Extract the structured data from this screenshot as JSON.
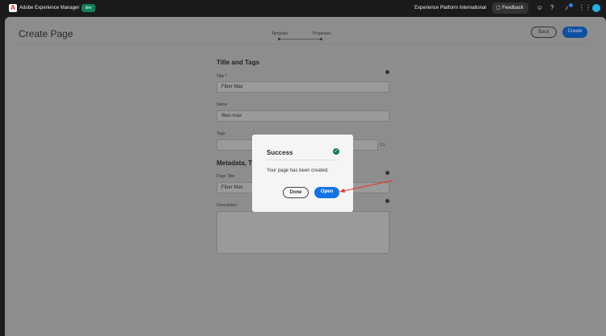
{
  "topbar": {
    "app": "Adobe Experience Manager",
    "env": "dev",
    "org": "Experience Platform International",
    "feedback": "Feedback"
  },
  "header": {
    "title": "Create Page",
    "steps": [
      "Template",
      "Properties"
    ],
    "back": "Back",
    "create": "Create"
  },
  "form": {
    "section1": "Title and Tags",
    "title_label": "Title *",
    "title_value": "Fiber Max",
    "name_label": "Name",
    "name_value": "fiber-max",
    "tags_label": "Tags",
    "section2": "Metadata, Title",
    "page_title_label": "Page Title",
    "page_title_value": "Fiber Max",
    "description_label": "Description"
  },
  "dialog": {
    "title": "Success",
    "message": "Your page has been created.",
    "done": "Done",
    "open": "Open"
  },
  "colors": {
    "accent": "#1473e6",
    "success": "#12805c",
    "annotation": "#e8322b"
  }
}
